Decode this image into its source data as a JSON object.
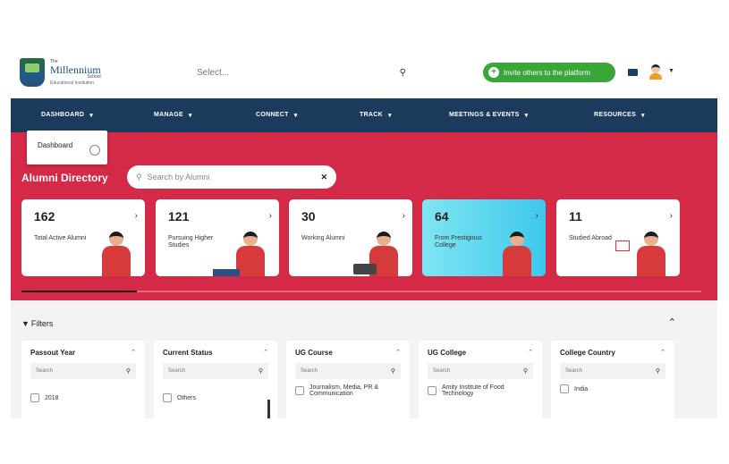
{
  "header": {
    "logo": {
      "small": "The",
      "name": "Millennium",
      "sub": "School",
      "tag": "Educational Institution"
    },
    "select_placeholder": "Select...",
    "invite_label": "Invite others to the platform"
  },
  "nav": [
    "DASHBOARD",
    "MANAGE",
    "CONNECT",
    "TRACK",
    "MEETINGS & EVENTS",
    "RESOURCES"
  ],
  "dropdown": {
    "item": "Dashboard"
  },
  "directory": {
    "title": "Alumni Directory",
    "search_placeholder": "Search by Alumni",
    "progress": 0.17
  },
  "cards": [
    {
      "value": "162",
      "label": "Total Active Alumni",
      "highlight": false
    },
    {
      "value": "121",
      "label": "Pursuing Higher Studies",
      "highlight": false
    },
    {
      "value": "30",
      "label": "Working Alumni",
      "highlight": false
    },
    {
      "value": "64",
      "label": "From Prestigious College",
      "highlight": true
    },
    {
      "value": "11",
      "label": "Studied Abroad",
      "highlight": false
    }
  ],
  "filters": {
    "title": "Filters",
    "groups": [
      {
        "name": "Passout Year",
        "search": "Search",
        "items": [
          "2018"
        ]
      },
      {
        "name": "Current Status",
        "search": "Search",
        "items": [
          "Others"
        ]
      },
      {
        "name": "UG Course",
        "search": "Search",
        "items": [
          "Journalism, Media, PR & Communication"
        ]
      },
      {
        "name": "UG College",
        "search": "Search",
        "items": [
          "Amity Institute of Food Technology"
        ]
      },
      {
        "name": "College Country",
        "search": "Search",
        "items": [
          "India"
        ]
      }
    ]
  },
  "colors": {
    "navy": "#1c3a5c",
    "brand_red": "#d42a47",
    "invite_green": "#3aa63a",
    "highlight_cyan": "#3fc8ec"
  }
}
